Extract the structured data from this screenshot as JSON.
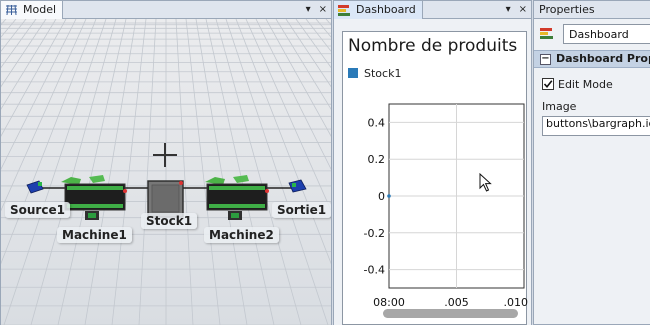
{
  "model_tab": {
    "label": "Model",
    "icon": "grid-icon",
    "controls": [
      "▾",
      "×"
    ]
  },
  "model_objects": [
    {
      "label": "Source1",
      "type": "source"
    },
    {
      "label": "Machine1",
      "type": "processor"
    },
    {
      "label": "Stock1",
      "type": "queue"
    },
    {
      "label": "Machine2",
      "type": "processor"
    },
    {
      "label": "Sortie1",
      "type": "sink"
    }
  ],
  "dashboard_tab": {
    "label": "Dashboard",
    "icon": "bar-chart-icon",
    "controls": [
      "▾",
      "×"
    ]
  },
  "chart": {
    "title": "Nombre de produits",
    "legend": [
      {
        "name": "Stock1",
        "color": "#2a7ab8"
      }
    ]
  },
  "chart_data": {
    "type": "line",
    "title": "Nombre de produits",
    "xlabel": "",
    "ylabel": "",
    "x_ticks": [
      "08:00",
      ".005",
      ".010"
    ],
    "y_ticks": [
      "0.4",
      "0.2",
      "0",
      "-0.2",
      "-0.4"
    ],
    "ylim": [
      -0.5,
      0.5
    ],
    "grid": true,
    "legend_position": "top-left",
    "series": [
      {
        "name": "Stock1",
        "color": "#2a7ab8",
        "x": [
          "08:00"
        ],
        "values": [
          0
        ]
      }
    ]
  },
  "properties": {
    "header": "Properties",
    "name_value": "Dashboard",
    "section_title": "Dashboard Prope",
    "collapse_symbol": "−",
    "edit_mode_label": "Edit Mode",
    "edit_mode_checked": true,
    "image_label": "Image",
    "image_value": "buttons\\bargraph.ico"
  }
}
